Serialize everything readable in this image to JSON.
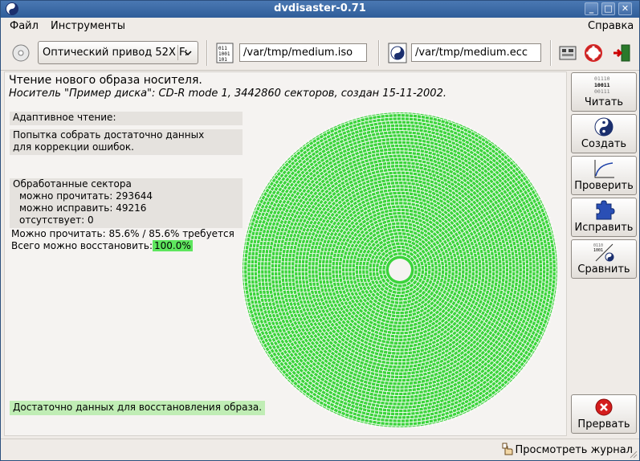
{
  "window": {
    "title": "dvdisaster-0.71"
  },
  "menu": {
    "file": "Файл",
    "tools": "Инструменты",
    "help": "Справка"
  },
  "toolbar": {
    "drive": "Оптический привод 52X F:",
    "image_path": "/var/tmp/medium.iso",
    "ecc_path": "/var/tmp/medium.ecc"
  },
  "header": {
    "title": "Чтение нового образа носителя.",
    "subtitle": "Носитель \"Пример диска\": CD-R mode 1, 3442860 секторов, создан 15-11-2002."
  },
  "info": {
    "adaptive": "Адаптивное чтение:",
    "attempt_line1": "Попытка собрать достаточно данных",
    "attempt_line2": "для коррекции ошибок.",
    "processed": "Обработанные сектора",
    "readable": "можно прочитать: 293644",
    "correctable": "можно исправить: 49216",
    "missing": "отсутствует: 0",
    "readable_pct": "Можно прочитать: 85.6% / 85.6% требуется",
    "recoverable_label": "Всего можно восстановить:",
    "recoverable_value": "100.0%",
    "status_message": "Достаточно данных для восстановления образа."
  },
  "disc": {
    "fill_color": "#3bd33b",
    "ring_color": "#ffffff"
  },
  "actions": {
    "read": "Читать",
    "create": "Создать",
    "verify": "Проверить",
    "fix": "Исправить",
    "compare": "Сравнить",
    "stop": "Прервать"
  },
  "status": {
    "log_link": "Просмотреть журнал"
  }
}
